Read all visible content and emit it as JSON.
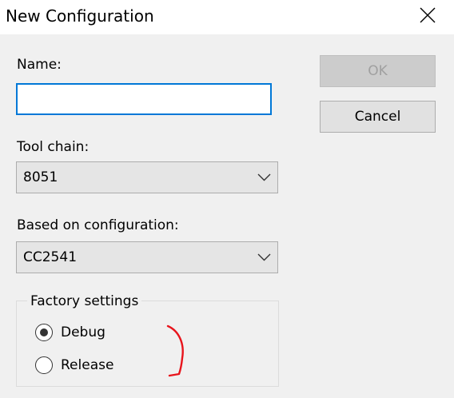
{
  "window": {
    "title": "New Configuration",
    "close_icon": "close-icon"
  },
  "form": {
    "name_label": "Name:",
    "name_value": "",
    "tool_chain_label": "Tool chain:",
    "tool_chain_value": "8051",
    "based_on_label": "Based on configuration:",
    "based_on_value": "CC2541"
  },
  "buttons": {
    "ok_label": "OK",
    "ok_enabled": false,
    "cancel_label": "Cancel"
  },
  "factory": {
    "title": "Factory settings",
    "options": [
      {
        "label": "Debug",
        "selected": true
      },
      {
        "label": "Release",
        "selected": false
      }
    ]
  },
  "colors": {
    "focus_border": "#0078d7",
    "dialog_bg": "#f0f0f0",
    "annotation_mark": "#e8141c"
  }
}
